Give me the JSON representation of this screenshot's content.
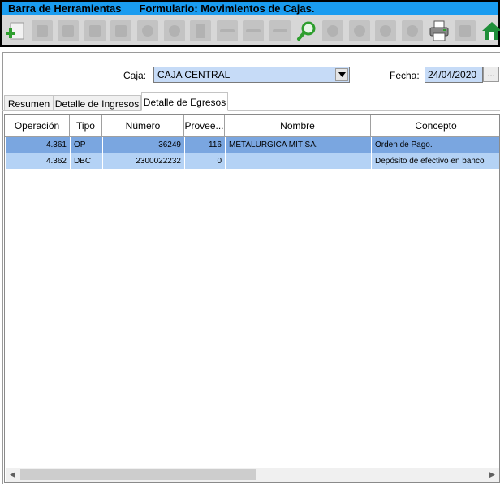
{
  "title_bar": {
    "toolbar_label": "Barra de Herramientas",
    "form_label": "Formulario: Movimientos de Cajas."
  },
  "toolbar_icons": [
    {
      "name": "add-icon",
      "enabled": true
    },
    {
      "name": "save-icon",
      "enabled": false
    },
    {
      "name": "save-as-icon",
      "enabled": false
    },
    {
      "name": "edit-icon",
      "enabled": false
    },
    {
      "name": "delete-icon",
      "enabled": false
    },
    {
      "name": "undo-icon",
      "enabled": false
    },
    {
      "name": "help-icon",
      "enabled": false
    },
    {
      "name": "film-icon",
      "enabled": false
    },
    {
      "name": "field-icon",
      "enabled": false
    },
    {
      "name": "list-icon",
      "enabled": false
    },
    {
      "name": "grid-icon",
      "enabled": false
    },
    {
      "name": "search-icon",
      "enabled": true
    },
    {
      "name": "first-record-icon",
      "enabled": false
    },
    {
      "name": "previous-record-icon",
      "enabled": false
    },
    {
      "name": "next-record-icon",
      "enabled": false
    },
    {
      "name": "last-record-icon",
      "enabled": false
    },
    {
      "name": "print-icon",
      "enabled": true
    },
    {
      "name": "export-icon",
      "enabled": false
    },
    {
      "name": "home-icon",
      "enabled": true
    }
  ],
  "colors": {
    "title_bg": "#1a9cf0",
    "selected_row": "#7aa6e0",
    "row_bg": "#b4d2f5",
    "field_bg": "#c6dbf7",
    "search_green": "#2e9e2e",
    "home_green": "#1f8f3a"
  },
  "form": {
    "caja_label": "Caja:",
    "caja_value": "CAJA CENTRAL",
    "fecha_label": "Fecha:",
    "fecha_value": "24/04/2020",
    "fecha_button": "..."
  },
  "tabs": [
    {
      "label": "Resumen",
      "active": false
    },
    {
      "label": "Detalle de Ingresos",
      "active": false
    },
    {
      "label": "Detalle de Egresos",
      "active": true
    }
  ],
  "grid": {
    "columns": [
      "Operación",
      "Tipo",
      "Número",
      "Provee...",
      "Nombre",
      "Concepto"
    ],
    "rows": [
      {
        "operacion": "4.361",
        "tipo": "OP",
        "numero": "36249",
        "proveedor": "116",
        "nombre": "METALURGICA MIT SA.",
        "concepto": "Orden de Pago.",
        "selected": true
      },
      {
        "operacion": "4.362",
        "tipo": "DBC",
        "numero": "2300022232",
        "proveedor": "0",
        "nombre": "",
        "concepto": "Depósito de efectivo en banco",
        "selected": false
      }
    ]
  }
}
